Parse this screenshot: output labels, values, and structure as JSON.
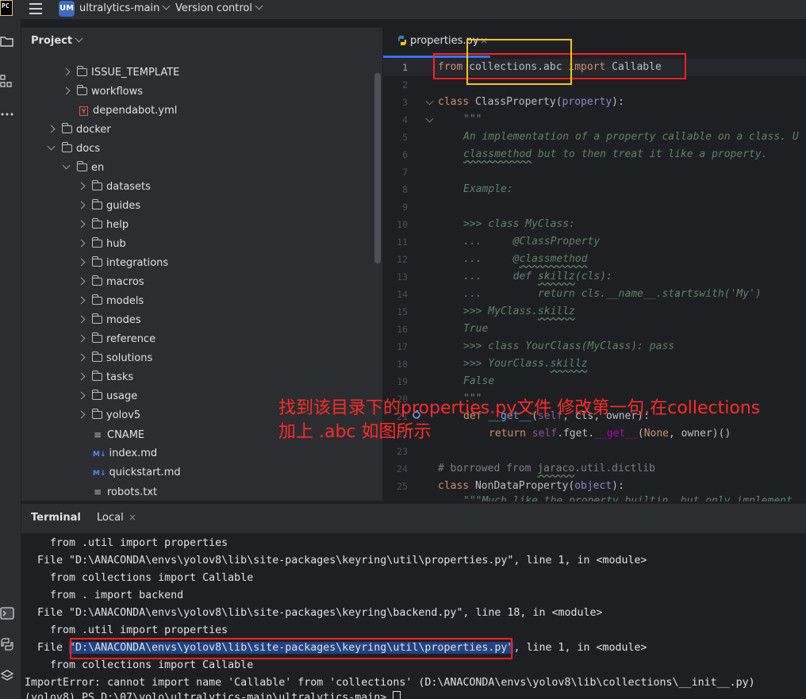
{
  "topbar": {
    "app_logo": "PC",
    "project_badge": "UM",
    "project_name": "ultralytics-main",
    "vcs_label": "Version control"
  },
  "project_panel": {
    "title": "Project",
    "tree": [
      {
        "label": "ISSUE_TEMPLATE",
        "type": "folder"
      },
      {
        "label": "workflows",
        "type": "folder"
      },
      {
        "label": "dependabot.yml",
        "type": "yml"
      },
      {
        "label": "docker",
        "type": "folder"
      },
      {
        "label": "docs",
        "type": "folder",
        "open": true
      },
      {
        "label": "en",
        "type": "folder",
        "open": true
      },
      {
        "label": "datasets",
        "type": "folder"
      },
      {
        "label": "guides",
        "type": "folder"
      },
      {
        "label": "help",
        "type": "folder"
      },
      {
        "label": "hub",
        "type": "folder"
      },
      {
        "label": "integrations",
        "type": "folder"
      },
      {
        "label": "macros",
        "type": "folder"
      },
      {
        "label": "models",
        "type": "folder"
      },
      {
        "label": "modes",
        "type": "folder"
      },
      {
        "label": "reference",
        "type": "folder"
      },
      {
        "label": "solutions",
        "type": "folder"
      },
      {
        "label": "tasks",
        "type": "folder"
      },
      {
        "label": "usage",
        "type": "folder"
      },
      {
        "label": "yolov5",
        "type": "folder"
      },
      {
        "label": "CNAME",
        "type": "text"
      },
      {
        "label": "index.md",
        "type": "md"
      },
      {
        "label": "quickstart.md",
        "type": "md"
      },
      {
        "label": "robots.txt",
        "type": "text"
      }
    ]
  },
  "editor": {
    "tab_label": "properties.py",
    "tab_close": "×",
    "line_numbers": [
      "1",
      "2",
      "3",
      "4",
      "5",
      "6",
      "7",
      "8",
      "9",
      "10",
      "11",
      "12",
      "13",
      "14",
      "15",
      "16",
      "17",
      "18",
      "19",
      "20",
      "21",
      "22",
      "23",
      "24",
      "25"
    ],
    "code": {
      "l1_from": "from",
      "l1_module": "collections.abc",
      "l1_import": "import",
      "l1_name": "Callable",
      "l3_class": "class",
      "l3_name": "ClassProperty",
      "l3_base": "property",
      "l4": "\"\"\"",
      "l5": "An implementation of a property callable on a class. U",
      "l6_a": "classmethod",
      "l6_b": " but to then treat it like a property.",
      "l8": "Example:",
      "l10": ">>> class MyClass:",
      "l11_a": "...     @ClassProperty",
      "l12_a": "...     @",
      "l12_b": "classmethod",
      "l13_a": "...     def ",
      "l13_b": "skillz",
      "l13_c": "(cls):",
      "l14": "...         return cls.__name__.startswith('My')",
      "l15_a": ">>> MyClass.",
      "l15_b": "skillz",
      "l16": "True",
      "l17": ">>> class YourClass(MyClass): pass",
      "l18_a": ">>> YourClass.",
      "l18_b": "skillz",
      "l19": "False",
      "l20": "\"\"\"",
      "l21_def": "def",
      "l21_name": "__get__",
      "l21_self": "self",
      "l21_rest": ", cls, owner):",
      "l22_ret": "return",
      "l22_self": "self",
      "l22_a": ".fget.",
      "l22_get": "__get__",
      "l22_none": "None",
      "l22_b": ", owner)()",
      "l24_a": "# borrowed from ",
      "l24_b": "jaraco",
      "l24_c": ".util.dictlib",
      "l25_class": "class",
      "l25_name": "NonDataProperty",
      "l25_base": "object",
      "l26": "\"\"\"Much like the property builtin, but only implement"
    }
  },
  "annotation": {
    "line1": "找到该目录下的properties.py文件 修改第一句.在collections",
    "line2": "加上 .abc  如图所示"
  },
  "terminal": {
    "title": "Terminal",
    "tab_label": "Local",
    "tab_close": "×",
    "lines": [
      "    from .util import properties",
      "  File \"D:\\ANACONDA\\envs\\yolov8\\lib\\site-packages\\keyring\\util\\properties.py\", line 1, in <module>",
      "    from collections import Callable",
      "    from . import backend",
      "  File \"D:\\ANACONDA\\envs\\yolov8\\lib\\site-packages\\keyring\\backend.py\", line 18, in <module>",
      "    from .util import properties",
      "    from collections import Callable",
      "ImportError: cannot import name 'Callable' from 'collections' (D:\\ANACONDA\\envs\\yolov8\\lib\\collections\\__init__.py)",
      "(yolov8) PS D:\\07\\yolo\\ultralytics-main\\ultralytics-main> "
    ],
    "line_file_prefix": "  File ",
    "line_file_highlight": "\"D:\\ANACONDA\\envs\\yolov8\\lib\\site-packages\\keyring\\util\\properties.py\"",
    "line_file_suffix": ", line 1, in <module>"
  }
}
